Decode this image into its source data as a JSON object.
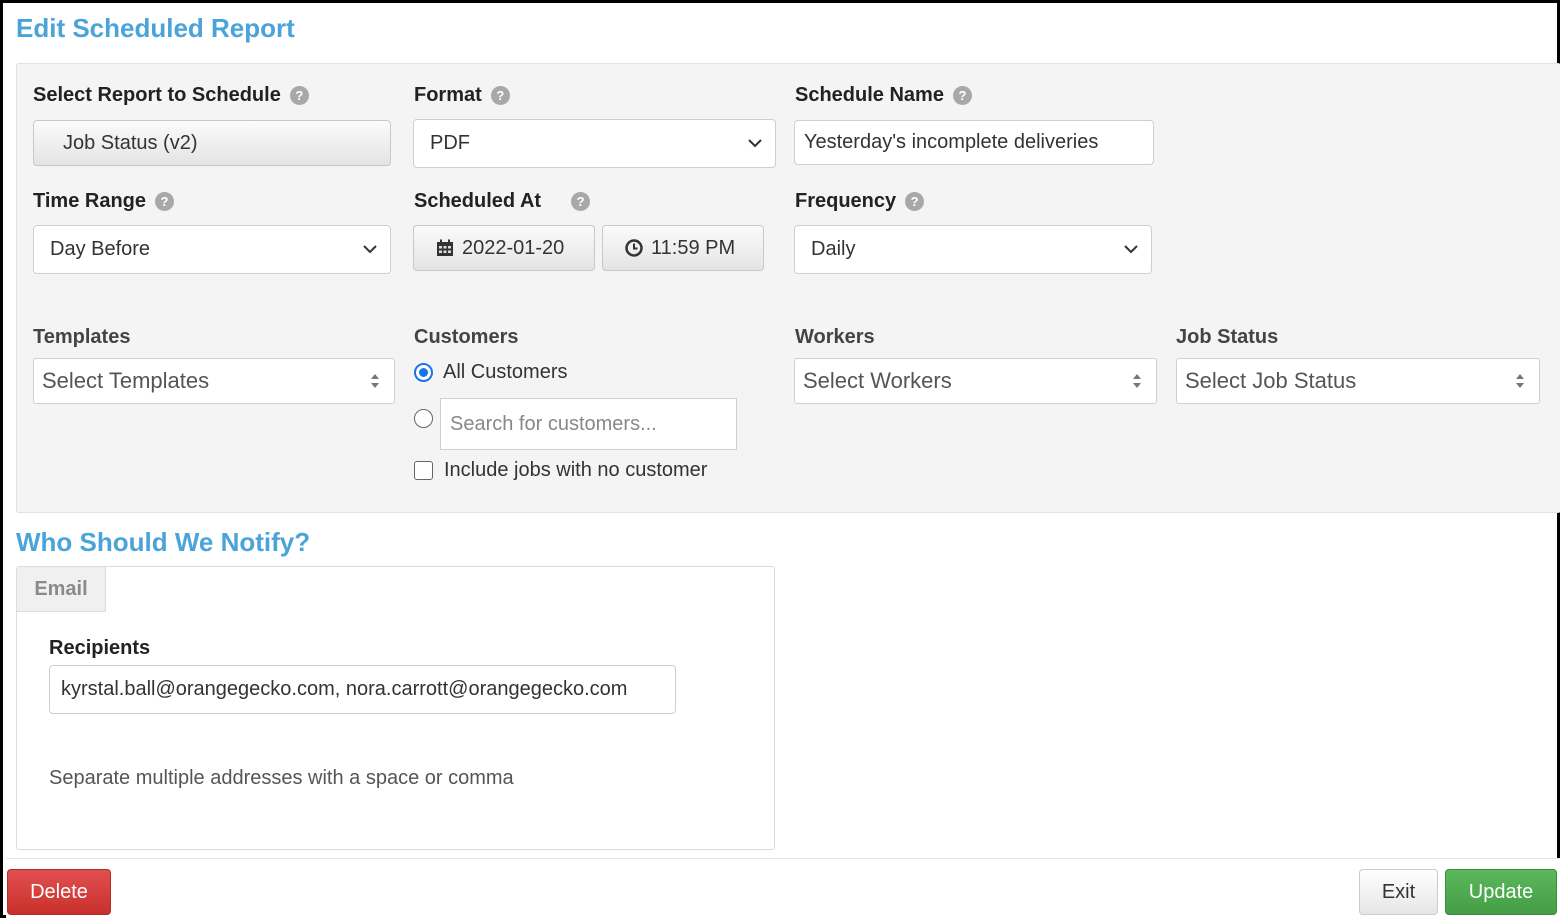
{
  "page": {
    "title": "Edit Scheduled Report"
  },
  "report_form": {
    "select_report": {
      "label": "Select Report to Schedule",
      "value": "Job Status (v2)"
    },
    "format": {
      "label": "Format",
      "value": "PDF"
    },
    "schedule_name": {
      "label": "Schedule Name",
      "value": "Yesterday's incomplete deliveries"
    },
    "time_range": {
      "label": "Time Range",
      "value": "Day Before"
    },
    "scheduled_at": {
      "label": "Scheduled At",
      "date": "2022-01-20",
      "time": "11:59 PM"
    },
    "frequency": {
      "label": "Frequency",
      "value": "Daily"
    },
    "help_glyph": "?"
  },
  "filters": {
    "templates": {
      "label": "Templates",
      "placeholder": "Select Templates"
    },
    "customers": {
      "label": "Customers",
      "all_option": "All Customers",
      "all_selected": true,
      "search_placeholder": "Search for customers...",
      "no_customer_label": "Include jobs with no customer",
      "no_customer_checked": false
    },
    "workers": {
      "label": "Workers",
      "placeholder": "Select Workers"
    },
    "job_status": {
      "label": "Job Status",
      "placeholder": "Select Job Status"
    }
  },
  "notify": {
    "title": "Who Should We Notify?",
    "tab_label": "Email",
    "recipients_label": "Recipients",
    "recipients_value": "kyrstal.ball@orangegecko.com, nora.carrott@orangegecko.com",
    "hint": "Separate multiple addresses with a space or comma"
  },
  "footer": {
    "delete_label": "Delete",
    "exit_label": "Exit",
    "update_label": "Update"
  },
  "icons": [
    "help-icon",
    "chevron-down-icon",
    "calendar-icon",
    "clock-icon",
    "sort-updown-icon"
  ],
  "colors": {
    "heading": "#4aa3d9",
    "danger": "#c9302c",
    "success": "#449d44",
    "radio": "#1a73e8"
  }
}
